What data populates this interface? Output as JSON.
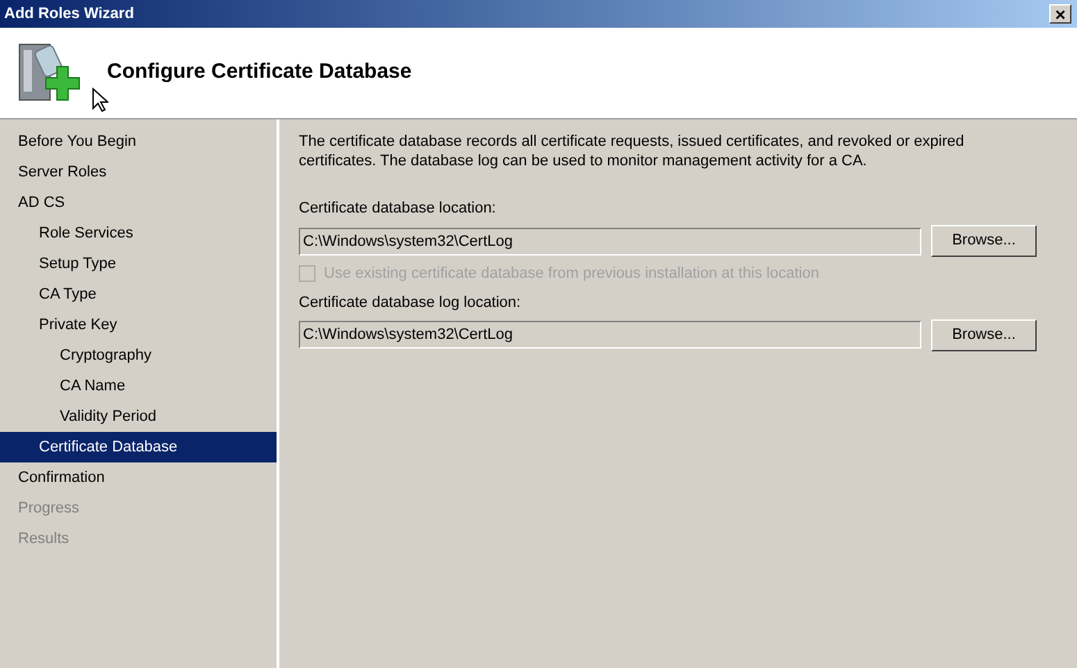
{
  "window": {
    "title": "Add Roles Wizard",
    "close": "×"
  },
  "header": {
    "title": "Configure Certificate Database"
  },
  "steps": [
    {
      "label": "Before You Begin",
      "selected": false,
      "disabled": false
    },
    {
      "label": "Server Roles",
      "selected": false,
      "disabled": false
    },
    {
      "label": "AD CS",
      "selected": false,
      "disabled": false,
      "children": [
        {
          "label": "Role Services",
          "selected": false,
          "disabled": false
        },
        {
          "label": "Setup Type",
          "selected": false,
          "disabled": false
        },
        {
          "label": "CA Type",
          "selected": false,
          "disabled": false
        },
        {
          "label": "Private Key",
          "selected": false,
          "disabled": false,
          "children": [
            {
              "label": "Cryptography",
              "selected": false,
              "disabled": false
            },
            {
              "label": "CA Name",
              "selected": false,
              "disabled": false
            },
            {
              "label": "Validity Period",
              "selected": false,
              "disabled": false
            }
          ]
        },
        {
          "label": "Certificate Database",
          "selected": true,
          "disabled": false
        }
      ]
    },
    {
      "label": "Confirmation",
      "selected": false,
      "disabled": false
    },
    {
      "label": "Progress",
      "selected": false,
      "disabled": true
    },
    {
      "label": "Results",
      "selected": false,
      "disabled": true
    }
  ],
  "content": {
    "description": "The certificate database records all certificate requests, issued certificates, and revoked or expired certificates. The database log can be used to monitor management activity for a CA.",
    "fields": [
      {
        "kind": "path",
        "label": "Certificate database location:",
        "value": "C:\\Windows\\system32\\CertLog",
        "button": "Browse..."
      },
      {
        "kind": "checkbox",
        "label": "Use existing certificate database from previous installation at this location",
        "checked": false,
        "disabled": true
      },
      {
        "kind": "path",
        "label": "Certificate database log location:",
        "value": "C:\\Windows\\system32\\CertLog",
        "button": "Browse..."
      }
    ]
  }
}
